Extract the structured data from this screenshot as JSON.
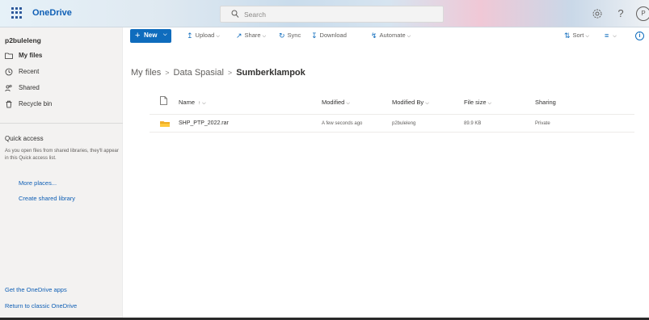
{
  "app": {
    "name": "OneDrive",
    "user_initial": "P"
  },
  "search": {
    "placeholder": "Search"
  },
  "icons": {
    "waffle": "app-launcher-icon",
    "settings": "gear-icon",
    "help": "help-icon",
    "search": "search-icon",
    "info": "info-icon"
  },
  "colors": {
    "brand_blue": "#0f6cbd",
    "folder_yellow": "#f5b43c",
    "sidebar_bg": "#f3f2f1"
  },
  "sidebar": {
    "user": "p2buleleng",
    "items": [
      {
        "label": "My files",
        "icon": "folder-icon",
        "active": true
      },
      {
        "label": "Recent",
        "icon": "clock-icon",
        "active": false
      },
      {
        "label": "Shared",
        "icon": "people-icon",
        "active": false
      },
      {
        "label": "Recycle bin",
        "icon": "recycle-bin-icon",
        "active": false
      }
    ],
    "quick_access": {
      "title": "Quick access",
      "description": "As you open files from shared libraries, they'll appear in this Quick access list.",
      "more_places": "More places...",
      "create_library": "Create shared library"
    },
    "get_apps": "Get the OneDrive apps",
    "classic": "Return to classic OneDrive"
  },
  "commandbar": {
    "new": "New",
    "upload": "Upload",
    "share": "Share",
    "sync": "Sync",
    "download": "Download",
    "automate": "Automate",
    "sort": "Sort"
  },
  "breadcrumb": [
    "My files",
    "Data Spasial",
    "Sumberklampok"
  ],
  "table": {
    "columns": {
      "name": "Name",
      "name_sort": "↑",
      "modified": "Modified",
      "modified_by": "Modified By",
      "file_size": "File size",
      "sharing": "Sharing"
    },
    "rows": [
      {
        "name": "SHP_PTP_2022.rar",
        "modified": "A few seconds ago",
        "modified_by": "p2buleleng",
        "file_size": "89.9 KB",
        "sharing": "Private"
      }
    ]
  }
}
